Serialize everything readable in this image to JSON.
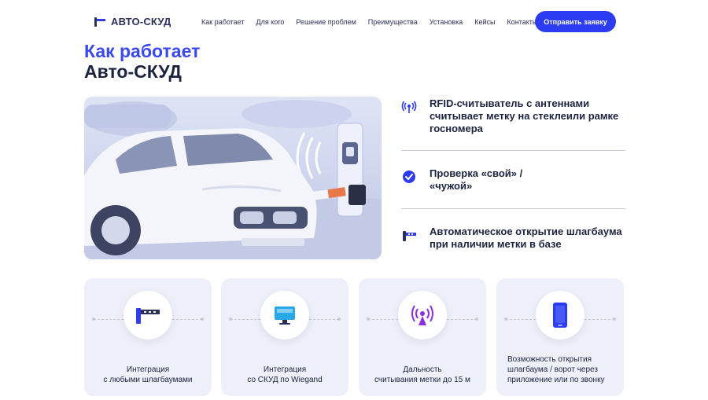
{
  "logo": {
    "name": "АВТО-СКУД"
  },
  "nav": {
    "items": [
      "Как работает",
      "Для кого",
      "Решение проблем",
      "Преимущества",
      "Установка",
      "Кейсы",
      "Контакты"
    ],
    "cta_label": "Отправить заявку"
  },
  "heading": {
    "line1": "Как работает",
    "line2": "Авто-СКУД"
  },
  "features": [
    {
      "icon": "rfid-antenna-icon",
      "text": "RFID-считыватель с антеннами считывает метку на стеклеили рамке госномера"
    },
    {
      "icon": "check-badge-icon",
      "text": "Проверка «свой» / «чужой»"
    },
    {
      "icon": "barrier-icon",
      "text": "Автоматическое открытие шлагбаума при наличии метки в базе"
    }
  ],
  "cards": [
    {
      "icon": "barrier-icon",
      "line1": "Интеграция",
      "line2": "с любыми шлагбаумами"
    },
    {
      "icon": "monitor-icon",
      "line1": "Интеграция",
      "line2": "со СКУД по Wiegand"
    },
    {
      "icon": "antenna-icon",
      "line1": "Дальность",
      "line2": "считывания метки до 15 м"
    },
    {
      "icon": "smartphone-icon",
      "line1": "Возможность открытия",
      "line2": "шлагбаума / ворот через",
      "line3": "приложение или по звонку"
    }
  ],
  "colors": {
    "accent": "#2c3cf2",
    "heading_accent": "#3a48f0",
    "text": "#1c2340",
    "card_bg": "#eef0f9"
  }
}
